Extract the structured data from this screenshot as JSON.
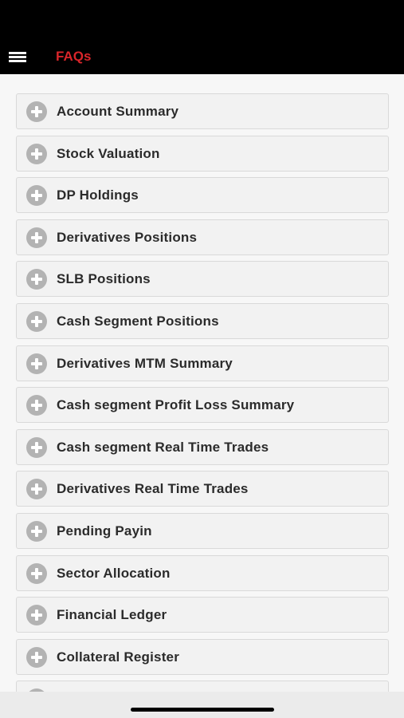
{
  "header": {
    "title": "FAQs",
    "menu_icon": "hamburger-menu-icon",
    "title_color": "#d9252a",
    "background": "#000000"
  },
  "faq": {
    "expand_icon": "plus-circle-icon",
    "items": [
      {
        "label": "Account Summary"
      },
      {
        "label": "Stock Valuation"
      },
      {
        "label": "DP Holdings"
      },
      {
        "label": "Derivatives Positions"
      },
      {
        "label": "SLB Positions"
      },
      {
        "label": "Cash Segment Positions"
      },
      {
        "label": "Derivatives MTM Summary"
      },
      {
        "label": "Cash segment Profit Loss Summary"
      },
      {
        "label": "Cash segment Real Time Trades"
      },
      {
        "label": "Derivatives Real Time Trades"
      },
      {
        "label": "Pending Payin"
      },
      {
        "label": "Sector Allocation"
      },
      {
        "label": "Financial Ledger"
      },
      {
        "label": "Collateral Register"
      },
      {
        "label": ""
      }
    ]
  }
}
